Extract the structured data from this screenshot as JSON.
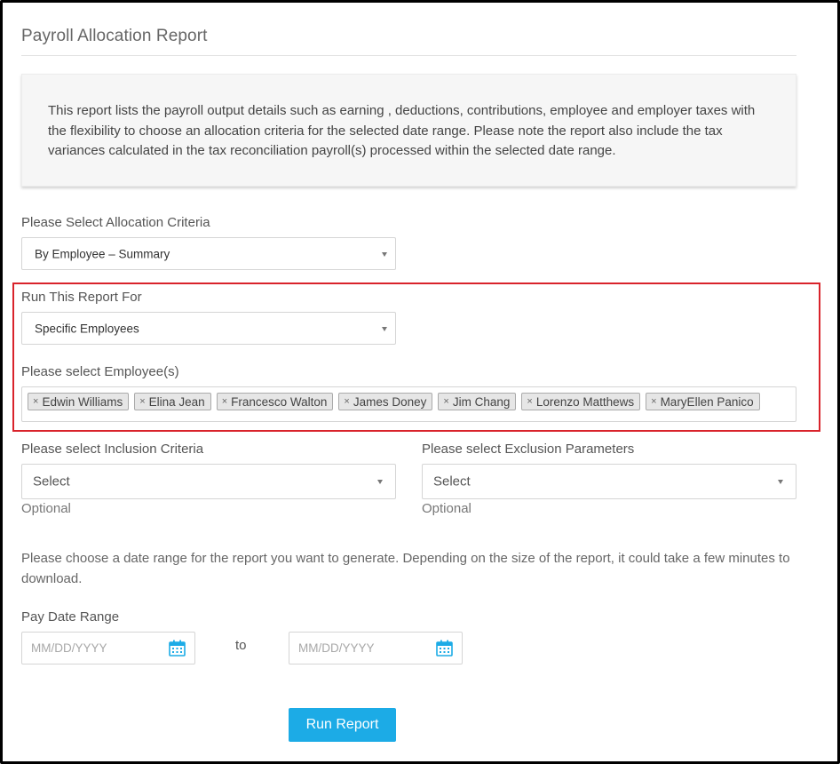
{
  "page": {
    "title": "Payroll Allocation Report",
    "description": "This report lists the payroll output details such as earning , deductions, contributions, employee and employer taxes with the flexibility to choose an allocation criteria for the selected date range. Please note the report also include the tax variances calculated in the tax reconciliation payroll(s) processed within the selected date range."
  },
  "allocation": {
    "label": "Please Select Allocation Criteria",
    "value": "By Employee – Summary"
  },
  "run_for": {
    "label": "Run This Report For",
    "value": "Specific Employees"
  },
  "employees": {
    "label": "Please select Employee(s)",
    "remove_glyph": "×",
    "selected": [
      "Edwin Williams",
      "Elina Jean",
      "Francesco Walton",
      "James Doney",
      "Jim Chang",
      "Lorenzo Matthews",
      "MaryEllen Panico"
    ]
  },
  "inclusion": {
    "label": "Please select Inclusion Criteria",
    "value": "Select",
    "hint": "Optional"
  },
  "exclusion": {
    "label": "Please select Exclusion Parameters",
    "value": "Select",
    "hint": "Optional"
  },
  "date_range": {
    "helper": "Please choose a date range for the report you want to generate. Depending on the size of the report, it could take a few minutes to download.",
    "label": "Pay Date Range",
    "from_placeholder": "MM/DD/YYYY",
    "to_label": "to",
    "to_placeholder": "MM/DD/YYYY",
    "icon": "calendar-icon"
  },
  "actions": {
    "run_label": "Run Report"
  },
  "colors": {
    "accent": "#1cabe6",
    "highlight_border": "#d9232b"
  }
}
